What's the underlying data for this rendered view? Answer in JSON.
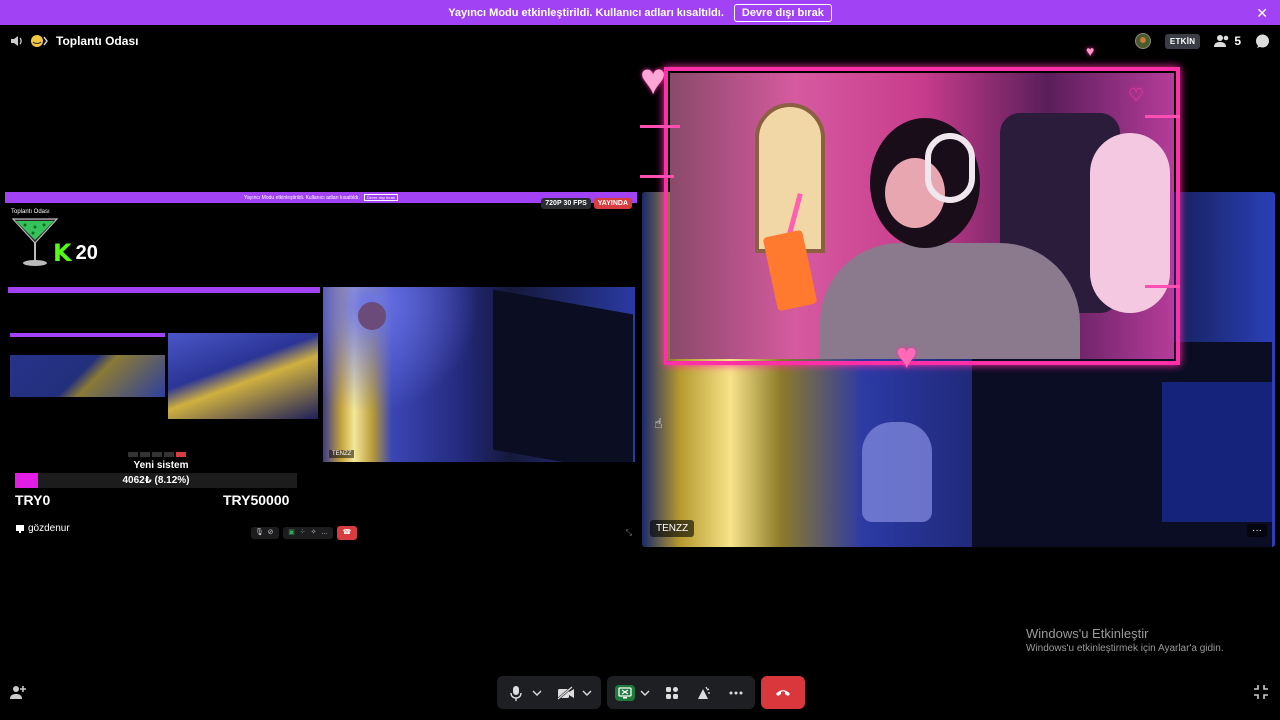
{
  "banner": {
    "text": "Yayıncı Modu etkinleştirildi. Kullanıcı adları kısaltıldı.",
    "button": "Devre dışı bırak",
    "close": "✕"
  },
  "header": {
    "room_title": "Toplantı Odası",
    "live_badge": "ETKİN",
    "participant_count": "5"
  },
  "left_tile": {
    "mini_banner_text": "Yayıncı Modu etkinleştirildi. Kullanıcı adları kısaltıldı.",
    "mini_banner_button": "Devre dışı bırak",
    "mini_title": "Toplantı Odası",
    "badge_res": "720P 30 FPS",
    "badge_live": "YAYINDA",
    "k_count": "20",
    "nested_name": "TENZZ",
    "nested_user": "gözdenur",
    "system_title": "Yeni sistem",
    "system_progress_text": "4062₺ (8.12%)",
    "system_progress_fraction": 0.0812,
    "range_min": "TRY0",
    "range_max": "TRY50000",
    "user_name": "gözdenur"
  },
  "right_tile": {
    "name": "TENZZ",
    "more": "···"
  },
  "watermark": {
    "title": "Windows'u Etkinleştir",
    "subtitle": "Windows'u etkinleştirmek için Ayarlar'a gidin."
  },
  "colors": {
    "banner": "#a142f4",
    "end_call": "#da373c",
    "screen_share": "#1f7a3e",
    "frame_pink": "#ff2fa8",
    "progress_fill": "#e21ee6"
  },
  "icons": [
    "speaker-icon",
    "emoji-icon",
    "avatar-icon",
    "people-icon",
    "chat-icon",
    "mic-icon",
    "camera-off-icon",
    "screen-share-icon",
    "activities-icon",
    "soundboard-icon",
    "more-icon",
    "hangup-icon",
    "add-person-icon",
    "fullscreen-exit-icon"
  ]
}
